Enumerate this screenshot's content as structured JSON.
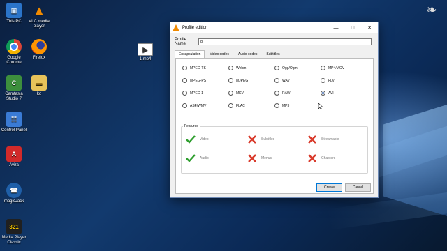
{
  "desktop": {
    "icons": [
      {
        "label": "This PC",
        "icon": "computer-icon"
      },
      {
        "label": "VLC media player",
        "icon": "vlc-icon"
      },
      {
        "label": "Google Chrome",
        "icon": "chrome-icon"
      },
      {
        "label": "Firefox",
        "icon": "firefox-icon"
      },
      {
        "label": "Camtasia Studio 7",
        "icon": "camtasia-icon"
      },
      {
        "label": "ko",
        "icon": "folder-icon"
      },
      {
        "label": "Control Panel",
        "icon": "control-panel-icon"
      },
      {
        "label": "Avira",
        "icon": "avira-icon"
      },
      {
        "label": "magicJack",
        "icon": "magicjack-icon"
      },
      {
        "label": "Media Player Classic",
        "icon": "media-player-classic-icon"
      },
      {
        "label": "1.mp4",
        "icon": "video-file-icon"
      }
    ]
  },
  "dialog": {
    "title": "Profile edition",
    "profile_name_label": "Profile Name",
    "profile_name_value": "g",
    "tabs": [
      "Encapsulation",
      "Video codec",
      "Audio codec",
      "Subtitles"
    ],
    "active_tab": "Encapsulation",
    "formats": [
      {
        "label": "MPEG-TS",
        "selected": false
      },
      {
        "label": "Webm",
        "selected": false
      },
      {
        "label": "Ogg/Ogm",
        "selected": false
      },
      {
        "label": "MP4/MOV",
        "selected": false
      },
      {
        "label": "MPEG-PS",
        "selected": false
      },
      {
        "label": "MJPEG",
        "selected": false
      },
      {
        "label": "WAV",
        "selected": false
      },
      {
        "label": "FLV",
        "selected": false
      },
      {
        "label": "MPEG 1",
        "selected": false
      },
      {
        "label": "MKV",
        "selected": false
      },
      {
        "label": "RAW",
        "selected": false
      },
      {
        "label": "AVI",
        "selected": true
      },
      {
        "label": "ASF/WMV",
        "selected": false
      },
      {
        "label": "FLAC",
        "selected": false
      },
      {
        "label": "MP3",
        "selected": false
      }
    ],
    "features_label": "Features",
    "features": [
      {
        "label": "Video",
        "supported": true
      },
      {
        "label": "Subtitles",
        "supported": false
      },
      {
        "label": "Streamable",
        "supported": false
      },
      {
        "label": "Audio",
        "supported": true
      },
      {
        "label": "Menus",
        "supported": false
      },
      {
        "label": "Chapters",
        "supported": false
      }
    ],
    "create_label": "Create",
    "cancel_label": "Cancel",
    "colors": {
      "check": "#2e9e2e",
      "cross": "#d93a2b",
      "accent": "#0078d7"
    }
  }
}
